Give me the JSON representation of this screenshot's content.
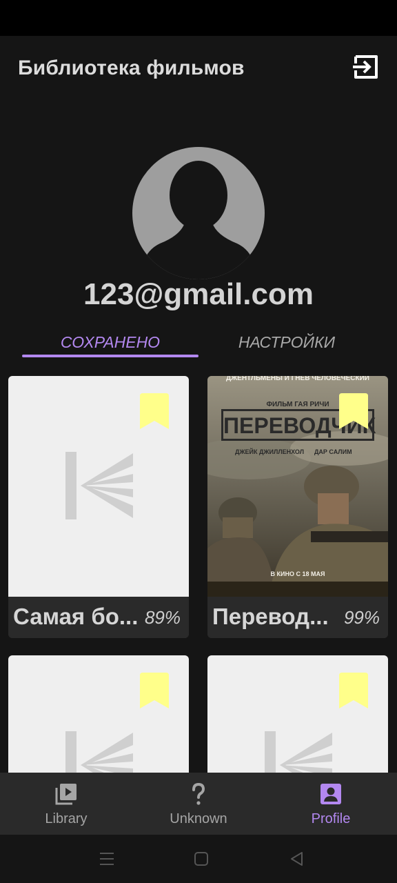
{
  "app": {
    "title": "Библиотека фильмов"
  },
  "profile": {
    "email": "123@gmail.com"
  },
  "tabs": [
    {
      "label": "СОХРАНЕНО",
      "active": true
    },
    {
      "label": "НАСТРОЙКИ",
      "active": false
    }
  ],
  "movies": [
    {
      "title": "Самая бо...",
      "rating": "89%",
      "poster": "placeholder",
      "bookmarked": true
    },
    {
      "title": "Перевод...",
      "rating": "99%",
      "poster": "image",
      "bookmarked": true,
      "poster_text": {
        "top": "ДЖЕНТЛЬМЕНЫ И ГНЕВ ЧЕЛОВЕЧЕСКИЙ",
        "director": "ФИЛЬМ ГАЯ РИЧИ",
        "name": "ПЕРЕВОДЧИК",
        "actor1": "ДЖЕЙК ДЖИЛЛЕНХОЛ",
        "actor2": "ДАР САЛИМ",
        "release": "В КИНО С 18 МАЯ"
      }
    },
    {
      "title": "",
      "rating": "",
      "poster": "placeholder",
      "bookmarked": true
    },
    {
      "title": "",
      "rating": "",
      "poster": "placeholder",
      "bookmarked": true
    }
  ],
  "bottom_nav": [
    {
      "label": "Library",
      "icon": "video-library-icon",
      "active": false
    },
    {
      "label": "Unknown",
      "icon": "question-mark-icon",
      "active": false
    },
    {
      "label": "Profile",
      "icon": "account-box-icon",
      "active": true
    }
  ],
  "colors": {
    "accent": "#b388f0",
    "bookmark": "#ffff8a",
    "background": "#151515"
  }
}
